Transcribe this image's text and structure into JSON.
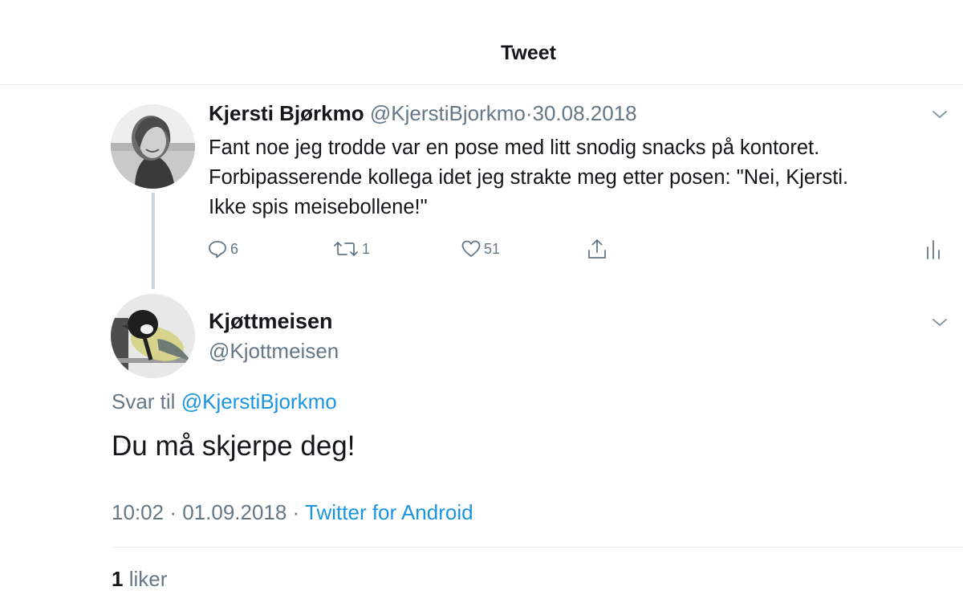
{
  "header": {
    "title": "Tweet"
  },
  "tweet": {
    "author_name": "Kjersti Bjørkmo",
    "author_handle": "@KjerstiBjorkmo",
    "separator": "·",
    "date": "30.08.2018",
    "text_lines": [
      "Fant noe jeg trodde var en pose med litt snodig snacks på kontoret.",
      "Forbipasserende kollega idet jeg strakte meg etter posen: \"Nei, Kjersti.",
      "Ikke spis meisebollene!\""
    ],
    "actions": {
      "reply_count": "6",
      "retweet_count": "1",
      "like_count": "51"
    },
    "icons": [
      "reply-icon",
      "retweet-icon",
      "like-icon",
      "share-icon",
      "stats-icon",
      "chevron-down-icon"
    ]
  },
  "reply": {
    "author_name": "Kjøttmeisen",
    "author_handle": "@Kjottmeisen",
    "reply_to_label": "Svar til",
    "reply_to_handle": "@KjerstiBjorkmo",
    "text": "Du må skjerpe deg!",
    "time": "10:02",
    "separator": "·",
    "date": "01.09.2018",
    "source": "Twitter for Android",
    "likes_count": "1",
    "likes_label": "liker"
  },
  "colors": {
    "text": "#14171a",
    "muted": "#657786",
    "link": "#1b95e0",
    "divider": "#e6ecf0",
    "thread_line": "#ccd6dd"
  }
}
